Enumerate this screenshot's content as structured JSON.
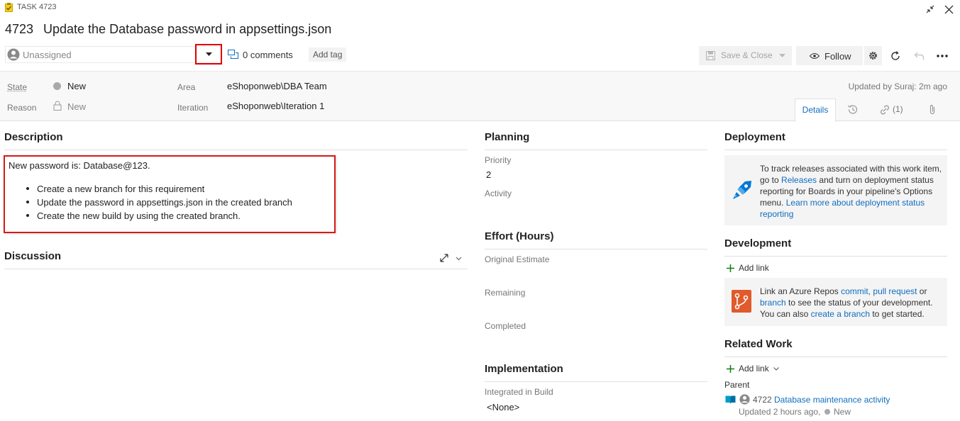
{
  "header": {
    "task_type": "TASK 4723",
    "id": "4723",
    "title": "Update the Database password in appsettings.json"
  },
  "toolbar": {
    "assignee_placeholder": "Unassigned",
    "comments": "0 comments",
    "add_tag": "Add tag",
    "save_close": "Save & Close",
    "follow": "Follow"
  },
  "meta": {
    "state_label": "State",
    "state_value": "New",
    "reason_label": "Reason",
    "reason_value": "New",
    "area_label": "Area",
    "area_value": "eShoponweb\\DBA Team",
    "iteration_label": "Iteration",
    "iteration_value": "eShoponweb\\Iteration 1",
    "updated": "Updated by Suraj: 2m ago"
  },
  "tabs": {
    "details": "Details",
    "links": "(1)"
  },
  "description": {
    "title": "Description",
    "intro": "New password is: Database@123.",
    "items": [
      "Create a new branch for this requirement",
      "Update the password in appsettings.json in the created branch",
      "Create the new build by using the created branch."
    ]
  },
  "discussion": {
    "title": "Discussion"
  },
  "planning": {
    "title": "Planning",
    "priority_label": "Priority",
    "priority_value": "2",
    "activity_label": "Activity"
  },
  "effort": {
    "title": "Effort (Hours)",
    "original_label": "Original Estimate",
    "remaining_label": "Remaining",
    "completed_label": "Completed"
  },
  "implementation": {
    "title": "Implementation",
    "build_label": "Integrated in Build",
    "build_value": "<None>"
  },
  "deployment": {
    "title": "Deployment",
    "t1": "To track releases associated with this work item,",
    "t2a": "go to ",
    "t2link": "Releases",
    "t2b": " and turn on deployment status",
    "t3": "reporting for Boards in your pipeline's Options",
    "t4a": "menu. ",
    "t4link": "Learn more about deployment status",
    "t5link": "reporting"
  },
  "development": {
    "title": "Development",
    "add_link": "Add link",
    "t1a": "Link an Azure Repos ",
    "t1link1": "commit,",
    "t1sp": " ",
    "t1link2": "pull request",
    "t1b": " or",
    "t2link": "branch",
    "t2b": " to see the status of your development.",
    "t3a": "You can also ",
    "t3link": "create a branch",
    "t3b": " to get started."
  },
  "related": {
    "title": "Related Work",
    "add_link": "Add link",
    "parent_label": "Parent",
    "parent_id": "4722",
    "parent_title": "Database maintenance activity",
    "parent_updated": "Updated 2 hours ago,",
    "parent_state": "New"
  },
  "colors": {
    "accent": "#106ebe",
    "highlight": "#e00000",
    "azure_blue": "#0078d4",
    "repos_orange": "#e05a2b",
    "task_yellow": "#f2cb1d"
  }
}
